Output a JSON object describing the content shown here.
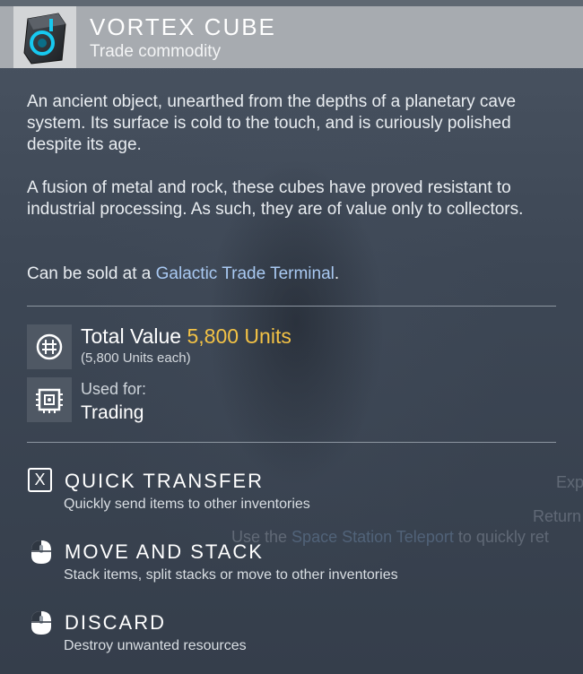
{
  "item": {
    "name": "VORTEX CUBE",
    "category": "Trade commodity",
    "icon": "vortex-cube-icon",
    "description": [
      "An ancient object, unearthed from the depths of a planetary cave system. Its surface is cold to the touch, and is curiously polished despite its age.",
      "A fusion of metal and rock, these cubes have proved resistant to industrial processing. As such, they are of value only to collectors."
    ],
    "sold_at_prefix": "Can be sold at a ",
    "sold_at_link": "Galactic Trade Terminal",
    "sold_at_suffix": "."
  },
  "value": {
    "label": "Total Value",
    "amount": "5,800 Units",
    "each": "(5,800 Units each)",
    "icon": "units-icon"
  },
  "usage": {
    "label": "Used for:",
    "value": "Trading",
    "icon": "chip-icon"
  },
  "actions": [
    {
      "key": "X",
      "title": "QUICK TRANSFER",
      "description": "Quickly send items to other inventories"
    },
    {
      "key": "mouse-left-icon",
      "title": "MOVE AND STACK",
      "description": "Stack items, split stacks or move to other inventories"
    },
    {
      "key": "mouse-left-icon",
      "title": "DISCARD",
      "description": "Destroy unwanted resources"
    }
  ],
  "background_text": {
    "exp": "Exp",
    "return": "Return",
    "teleport_prefix": "Use the ",
    "teleport_link": "Space Station Teleport",
    "teleport_suffix": " to quickly ret"
  },
  "colors": {
    "header_bg": "#a7abb0",
    "value_amount": "#f3c245",
    "link": "#a9c9f2",
    "panel_bg": "#3a4452"
  }
}
